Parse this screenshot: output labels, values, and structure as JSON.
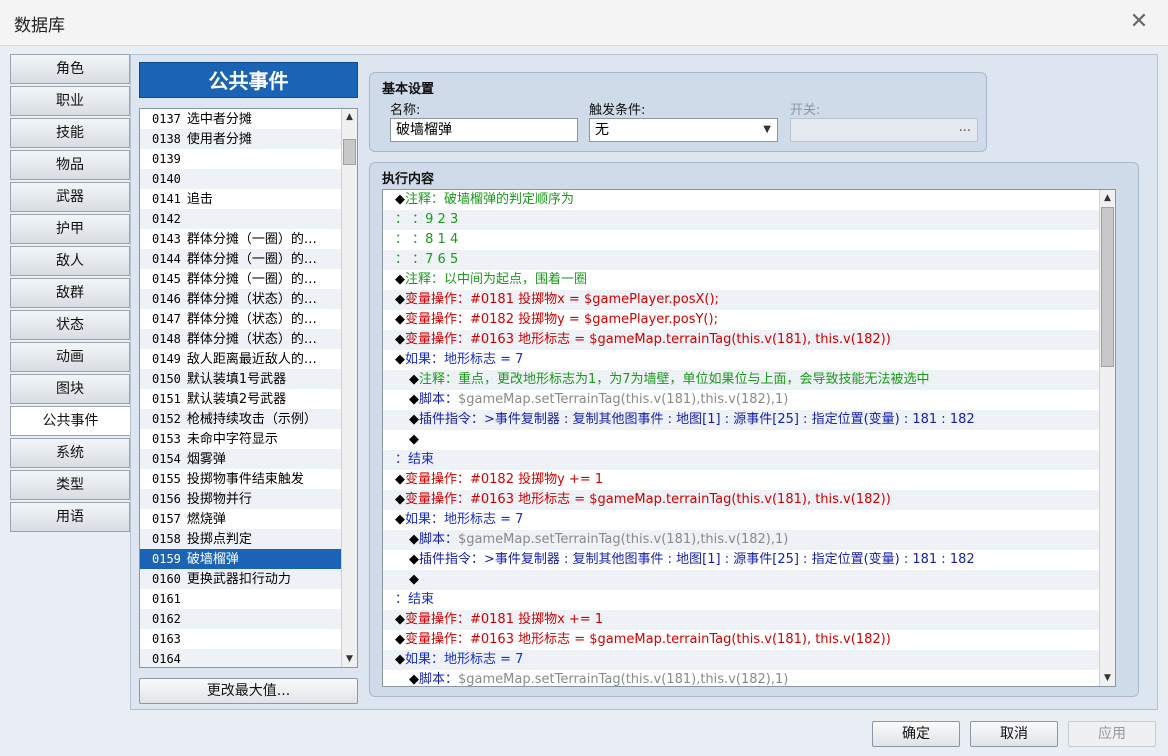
{
  "window": {
    "title": "数据库",
    "close_label": "✕"
  },
  "tabs": [
    {
      "label": "角色"
    },
    {
      "label": "职业"
    },
    {
      "label": "技能"
    },
    {
      "label": "物品"
    },
    {
      "label": "武器"
    },
    {
      "label": "护甲"
    },
    {
      "label": "敌人"
    },
    {
      "label": "敌群"
    },
    {
      "label": "状态"
    },
    {
      "label": "动画"
    },
    {
      "label": "图块"
    },
    {
      "label": "公共事件"
    },
    {
      "label": "系统"
    },
    {
      "label": "类型"
    },
    {
      "label": "用语"
    }
  ],
  "active_tab": "公共事件",
  "list": {
    "header": "公共事件",
    "selected_id": "0159",
    "items": [
      {
        "id": "0137",
        "name": "选中者分摊"
      },
      {
        "id": "0138",
        "name": "使用者分摊"
      },
      {
        "id": "0139",
        "name": ""
      },
      {
        "id": "0140",
        "name": ""
      },
      {
        "id": "0141",
        "name": "追击"
      },
      {
        "id": "0142",
        "name": ""
      },
      {
        "id": "0143",
        "name": "群体分摊（一圈）的…"
      },
      {
        "id": "0144",
        "name": "群体分摊（一圈）的…"
      },
      {
        "id": "0145",
        "name": "群体分摊（一圈）的…"
      },
      {
        "id": "0146",
        "name": "群体分摊（状态）的…"
      },
      {
        "id": "0147",
        "name": "群体分摊（状态）的…"
      },
      {
        "id": "0148",
        "name": "群体分摊（状态）的…"
      },
      {
        "id": "0149",
        "name": "敌人距离最近敌人的…"
      },
      {
        "id": "0150",
        "name": "默认装填1号武器"
      },
      {
        "id": "0151",
        "name": "默认装填2号武器"
      },
      {
        "id": "0152",
        "name": "枪械持续攻击（示例）"
      },
      {
        "id": "0153",
        "name": "未命中字符显示"
      },
      {
        "id": "0154",
        "name": "烟雾弹"
      },
      {
        "id": "0155",
        "name": "投掷物事件结束触发"
      },
      {
        "id": "0156",
        "name": "投掷物并行"
      },
      {
        "id": "0157",
        "name": "燃烧弹"
      },
      {
        "id": "0158",
        "name": "投掷点判定"
      },
      {
        "id": "0159",
        "name": "破墙榴弹"
      },
      {
        "id": "0160",
        "name": "更换武器扣行动力"
      },
      {
        "id": "0161",
        "name": ""
      },
      {
        "id": "0162",
        "name": ""
      },
      {
        "id": "0163",
        "name": ""
      },
      {
        "id": "0164",
        "name": ""
      }
    ],
    "change_max_button": "更改最大值..."
  },
  "basic": {
    "title": "基本设置",
    "name_label": "名称:",
    "name_value": "破墙榴弹",
    "trigger_label": "触发条件:",
    "trigger_value": "无",
    "switch_label": "开关:",
    "switch_value": "",
    "switch_button": "..."
  },
  "exec": {
    "title": "执行内容",
    "rows": [
      {
        "indent": 0,
        "marker": "◆",
        "parts": [
          {
            "t": "注释：破墙榴弹的判定顺序为",
            "c": "green"
          }
        ]
      },
      {
        "indent": 0,
        "marker": "",
        "parts": [
          {
            "t": "：     ：9 2 3",
            "c": "green"
          }
        ]
      },
      {
        "indent": 0,
        "marker": "",
        "parts": [
          {
            "t": "：     ：8 1 4",
            "c": "green"
          }
        ]
      },
      {
        "indent": 0,
        "marker": "",
        "parts": [
          {
            "t": "：     ：7 6 5",
            "c": "green"
          }
        ]
      },
      {
        "indent": 0,
        "marker": "◆",
        "parts": [
          {
            "t": "注释：以中间为起点，围着一圈",
            "c": "green"
          }
        ]
      },
      {
        "indent": 0,
        "marker": "◆",
        "parts": [
          {
            "t": "变量操作：#0181 投掷物x = $gamePlayer.posX();",
            "c": "red"
          }
        ]
      },
      {
        "indent": 0,
        "marker": "◆",
        "parts": [
          {
            "t": "变量操作：#0182 投掷物y = $gamePlayer.posY();",
            "c": "red"
          }
        ]
      },
      {
        "indent": 0,
        "marker": "◆",
        "parts": [
          {
            "t": "变量操作：#0163 地形标志 = $gameMap.terrainTag(this.v(181), this.v(182))",
            "c": "red"
          }
        ]
      },
      {
        "indent": 0,
        "marker": "◆",
        "parts": [
          {
            "t": "如果：地形标志 = 7",
            "c": "blue"
          }
        ]
      },
      {
        "indent": 1,
        "marker": "◆",
        "parts": [
          {
            "t": "注释：重点，更改地形标志为1，为7为墙壁，单位如果位与上面，会导致技能无法被选中",
            "c": "green"
          }
        ]
      },
      {
        "indent": 1,
        "marker": "◆",
        "parts": [
          {
            "t": "脚本：",
            "c": "navy"
          },
          {
            "t": "$gameMap.setTerrainTag(this.v(181),this.v(182),1)",
            "c": "gray"
          }
        ]
      },
      {
        "indent": 1,
        "marker": "◆",
        "parts": [
          {
            "t": "插件指令：>事件复制器 : 复制其他图事件 : 地图[1] : 源事件[25] : 指定位置(变量) : 181 : 182",
            "c": "navy"
          }
        ]
      },
      {
        "indent": 1,
        "marker": "◆",
        "parts": []
      },
      {
        "indent": 0,
        "marker": "",
        "parts": [
          {
            "t": "：结束",
            "c": "blue"
          }
        ]
      },
      {
        "indent": 0,
        "marker": "◆",
        "parts": [
          {
            "t": "变量操作：#0182 投掷物y += 1",
            "c": "red"
          }
        ]
      },
      {
        "indent": 0,
        "marker": "◆",
        "parts": [
          {
            "t": "变量操作：#0163 地形标志 = $gameMap.terrainTag(this.v(181), this.v(182))",
            "c": "red"
          }
        ]
      },
      {
        "indent": 0,
        "marker": "◆",
        "parts": [
          {
            "t": "如果：地形标志 = 7",
            "c": "blue"
          }
        ]
      },
      {
        "indent": 1,
        "marker": "◆",
        "parts": [
          {
            "t": "脚本：",
            "c": "navy"
          },
          {
            "t": "$gameMap.setTerrainTag(this.v(181),this.v(182),1)",
            "c": "gray"
          }
        ]
      },
      {
        "indent": 1,
        "marker": "◆",
        "parts": [
          {
            "t": "插件指令：>事件复制器 : 复制其他图事件 : 地图[1] : 源事件[25] : 指定位置(变量) : 181 : 182",
            "c": "navy"
          }
        ]
      },
      {
        "indent": 1,
        "marker": "◆",
        "parts": []
      },
      {
        "indent": 0,
        "marker": "",
        "parts": [
          {
            "t": "：结束",
            "c": "blue"
          }
        ]
      },
      {
        "indent": 0,
        "marker": "◆",
        "parts": [
          {
            "t": "变量操作：#0181 投掷物x += 1",
            "c": "red"
          }
        ]
      },
      {
        "indent": 0,
        "marker": "◆",
        "parts": [
          {
            "t": "变量操作：#0163 地形标志 = $gameMap.terrainTag(this.v(181), this.v(182))",
            "c": "red"
          }
        ]
      },
      {
        "indent": 0,
        "marker": "◆",
        "parts": [
          {
            "t": "如果：地形标志 = 7",
            "c": "blue"
          }
        ]
      },
      {
        "indent": 1,
        "marker": "◆",
        "parts": [
          {
            "t": "脚本：",
            "c": "navy"
          },
          {
            "t": "$gameMap.setTerrainTag(this.v(181),this.v(182),1)",
            "c": "gray"
          }
        ]
      }
    ]
  },
  "footer": {
    "ok": "确定",
    "cancel": "取消",
    "apply": "应用"
  },
  "scroll": {
    "up_glyph": "▲",
    "down_glyph": "▼",
    "dropdown_glyph": "▼"
  },
  "colors": {
    "accent": "#1a63b5",
    "comment": "#1a9a1a",
    "variable": "#d40000",
    "condition": "#1a2ec9",
    "plugin": "#141fa8",
    "script_arg": "#8a8a8a"
  }
}
